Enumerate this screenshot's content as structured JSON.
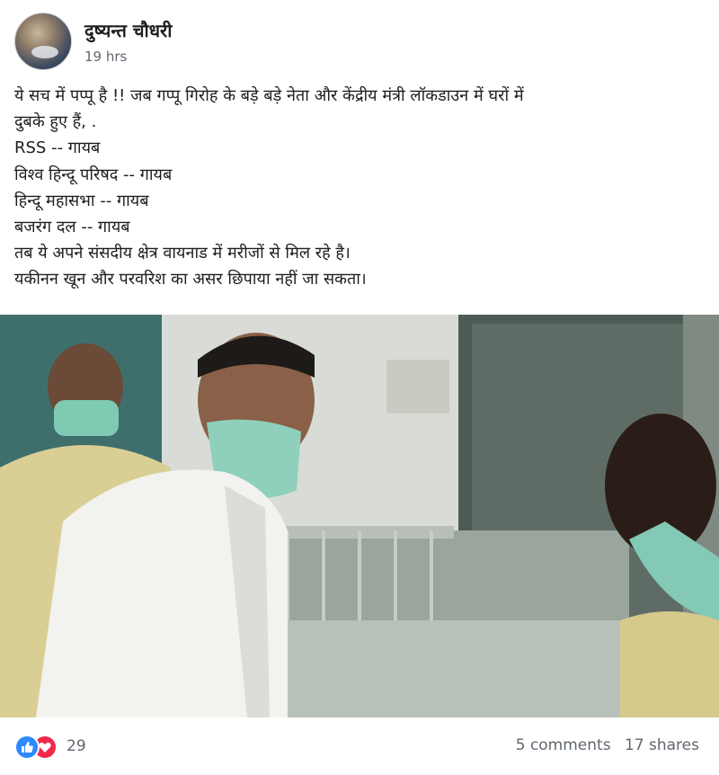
{
  "post": {
    "author": "दुष्यन्त चौधरी",
    "timestamp": "19 hrs",
    "text_lines": [
      "ये सच में पप्पू है !! जब गप्पू गिरोह के बड़े बड़े नेता और केंद्रीय मंत्री लॉकडाउन में घरों में",
      "दुबके हुए हैं, .",
      "RSS -- गायब",
      "विश्व हिन्दू परिषद -- गायब",
      "हिन्दू महासभा -- गायब",
      "बजरंग दल -- गायब",
      "तब ये अपने संसदीय क्षेत्र वायनाड में मरीजों से मिल रहे है।",
      "यकीनन खून और परवरिश का असर छिपाया नहीं जा सकता।"
    ]
  },
  "footer": {
    "reaction_icons": [
      "like-icon",
      "love-icon"
    ],
    "reaction_count": "29",
    "comments": "5 comments",
    "shares": "17 shares"
  },
  "colors": {
    "like": "#2e89ff",
    "love": "#f0284a",
    "meta_text": "#606770"
  }
}
